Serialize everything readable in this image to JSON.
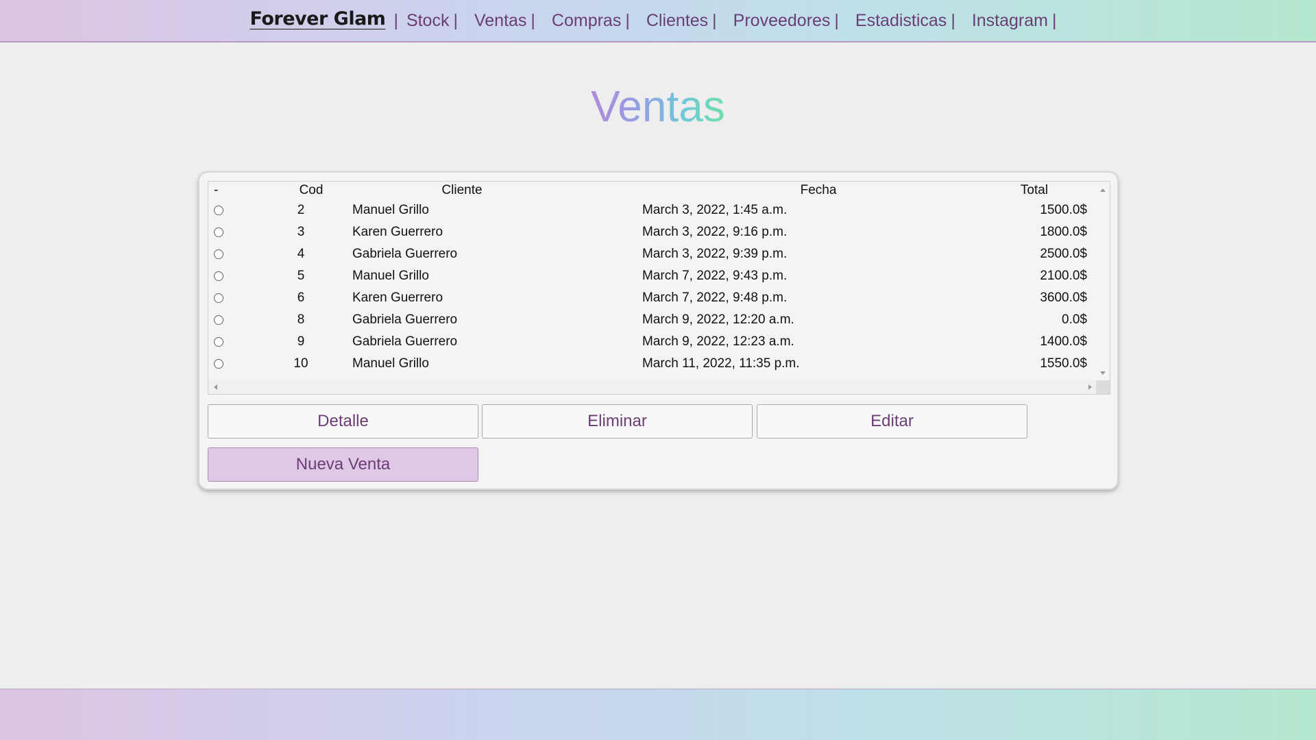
{
  "nav": {
    "brand": "Forever Glam",
    "separator": "|",
    "items": [
      {
        "label": "Stock"
      },
      {
        "label": "Ventas"
      },
      {
        "label": "Compras"
      },
      {
        "label": "Clientes"
      },
      {
        "label": "Proveedores"
      },
      {
        "label": "Estadisticas"
      },
      {
        "label": "Instagram"
      }
    ]
  },
  "page": {
    "title": "Ventas"
  },
  "table": {
    "headers": {
      "select": "-",
      "cod": "Cod",
      "cliente": "Cliente",
      "fecha": "Fecha",
      "total": "Total"
    },
    "rows": [
      {
        "cod": "2",
        "cliente": "Manuel Grillo",
        "fecha": "March 3, 2022, 1:45 a.m.",
        "total": "1500.0$"
      },
      {
        "cod": "3",
        "cliente": "Karen Guerrero",
        "fecha": "March 3, 2022, 9:16 p.m.",
        "total": "1800.0$"
      },
      {
        "cod": "4",
        "cliente": "Gabriela Guerrero",
        "fecha": "March 3, 2022, 9:39 p.m.",
        "total": "2500.0$"
      },
      {
        "cod": "5",
        "cliente": "Manuel Grillo",
        "fecha": "March 7, 2022, 9:43 p.m.",
        "total": "2100.0$"
      },
      {
        "cod": "6",
        "cliente": "Karen Guerrero",
        "fecha": "March 7, 2022, 9:48 p.m.",
        "total": "3600.0$"
      },
      {
        "cod": "8",
        "cliente": "Gabriela Guerrero",
        "fecha": "March 9, 2022, 12:20 a.m.",
        "total": "0.0$"
      },
      {
        "cod": "9",
        "cliente": "Gabriela Guerrero",
        "fecha": "March 9, 2022, 12:23 a.m.",
        "total": "1400.0$"
      },
      {
        "cod": "10",
        "cliente": "Manuel Grillo",
        "fecha": "March 11, 2022, 11:35 p.m.",
        "total": "1550.0$"
      }
    ]
  },
  "actions": {
    "detalle": "Detalle",
    "eliminar": "Eliminar",
    "editar": "Editar",
    "nueva_venta": "Nueva Venta"
  },
  "colors": {
    "accent_text": "#6a3e75",
    "primary_button": "#dfc7e6"
  }
}
